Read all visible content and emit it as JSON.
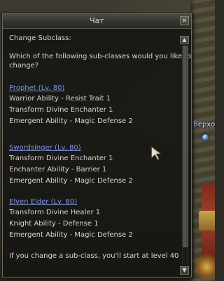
{
  "window": {
    "title": "Чат",
    "close_label": "×"
  },
  "scene": {
    "npc_name": "Верхо"
  },
  "dialog": {
    "heading": "Change Subclass:",
    "question_line1": "Which of the following sub-classes would you like to",
    "question_line2": "change?",
    "subclasses": [
      {
        "link": "Prophet (Lv. 80)",
        "abilities": [
          "Warrior Ability - Resist Trait 1",
          "Transform Divine Enchanter 1",
          "Emergent Ability - Magic Defense 2"
        ]
      },
      {
        "link": "Swordsinger (Lv. 80)",
        "abilities": [
          "Transform Divine Enchanter 1",
          "Enchanter Ability - Barrier 1",
          "Emergent Ability - Magic Defense 2"
        ]
      },
      {
        "link": "Elven Elder (Lv. 80)",
        "abilities": [
          "Transform Divine Healer 1",
          "Knight Ability - Defense 1",
          "Emergent Ability - Magic Defense 2"
        ]
      }
    ],
    "footer": "If you change a sub-class, you'll start at level 40"
  },
  "scrollbar": {
    "up_label": "▲",
    "down_label": "▼",
    "position_fraction": 0.0
  },
  "icons": {
    "close": "close-icon",
    "scroll_up": "arrow-up-icon",
    "scroll_down": "arrow-down-icon",
    "cursor": "mouse-pointer-icon",
    "npc_marker": "npc-marker-icon"
  },
  "colors": {
    "link": "#7e96de",
    "text": "#d8d6cc",
    "window_bg": "#161614",
    "npc_name": "#c9d8ff"
  }
}
